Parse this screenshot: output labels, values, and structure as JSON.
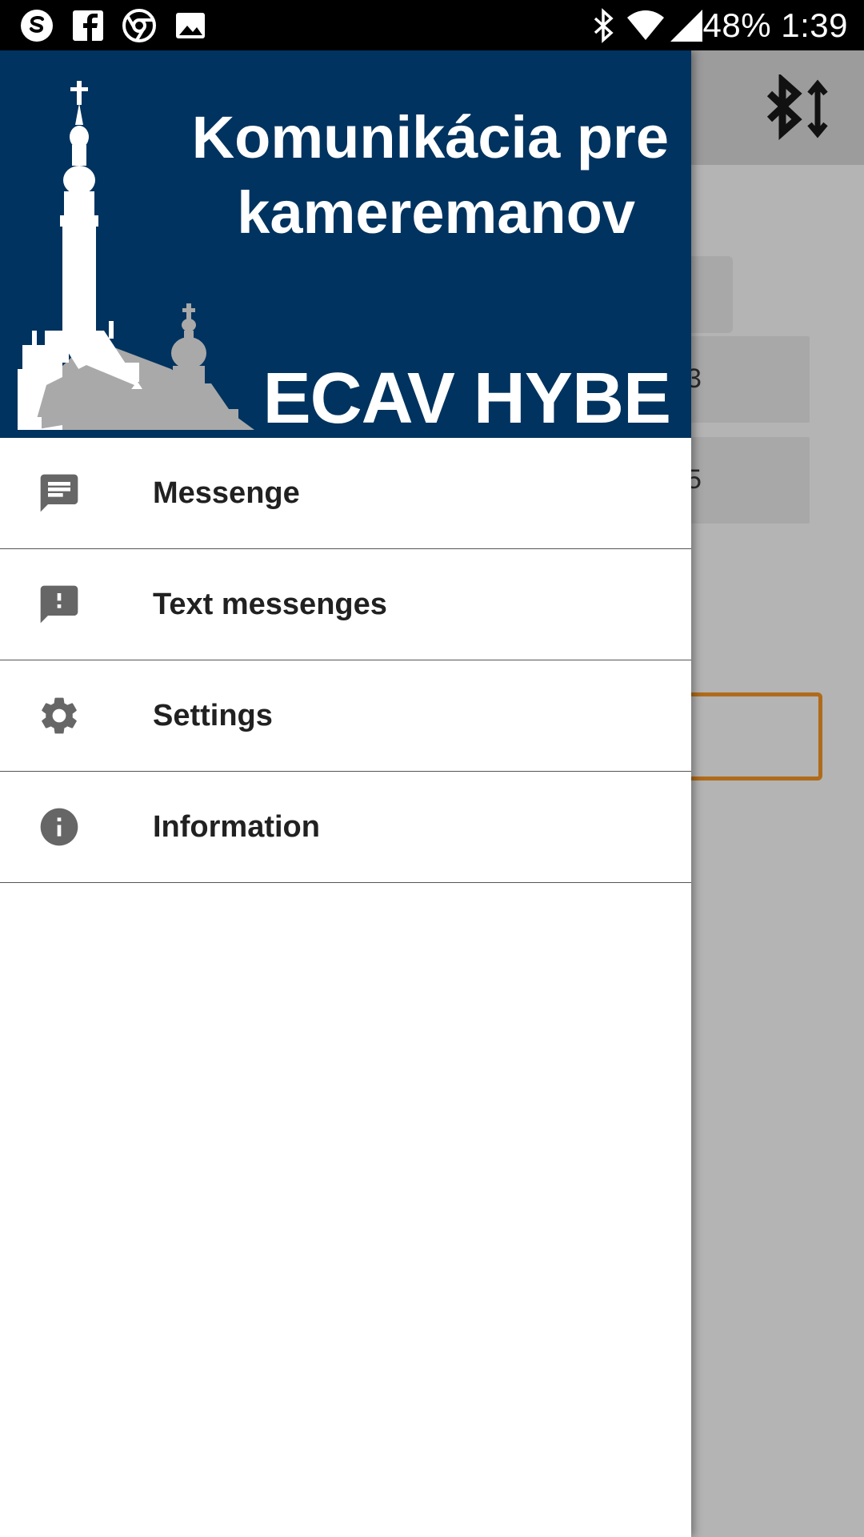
{
  "status_bar": {
    "left_icons": [
      "skype-icon",
      "facebook-icon",
      "chrome-icon",
      "gallery-icon"
    ],
    "right_icons": [
      "bluetooth-icon",
      "wifi-icon",
      "signal-icon"
    ],
    "battery": "48%",
    "time": "1:39"
  },
  "background_app": {
    "toolbar_icon": "bluetooth-transfer-icon",
    "fragments": [
      "3",
      "5"
    ]
  },
  "drawer": {
    "header": {
      "title_line1": "Komunikácia pre",
      "title_line2": "kameremanov",
      "brand": "ECAV HYBE",
      "colors": {
        "background": "#00335f",
        "church_front": "#ffffff",
        "church_back": "#a9a9a9"
      }
    },
    "menu": [
      {
        "label": "Messenge",
        "icon": "message-icon"
      },
      {
        "label": "Text messenges",
        "icon": "feedback-icon"
      },
      {
        "label": "Settings",
        "icon": "gear-icon"
      },
      {
        "label": "Information",
        "icon": "info-icon"
      }
    ]
  }
}
